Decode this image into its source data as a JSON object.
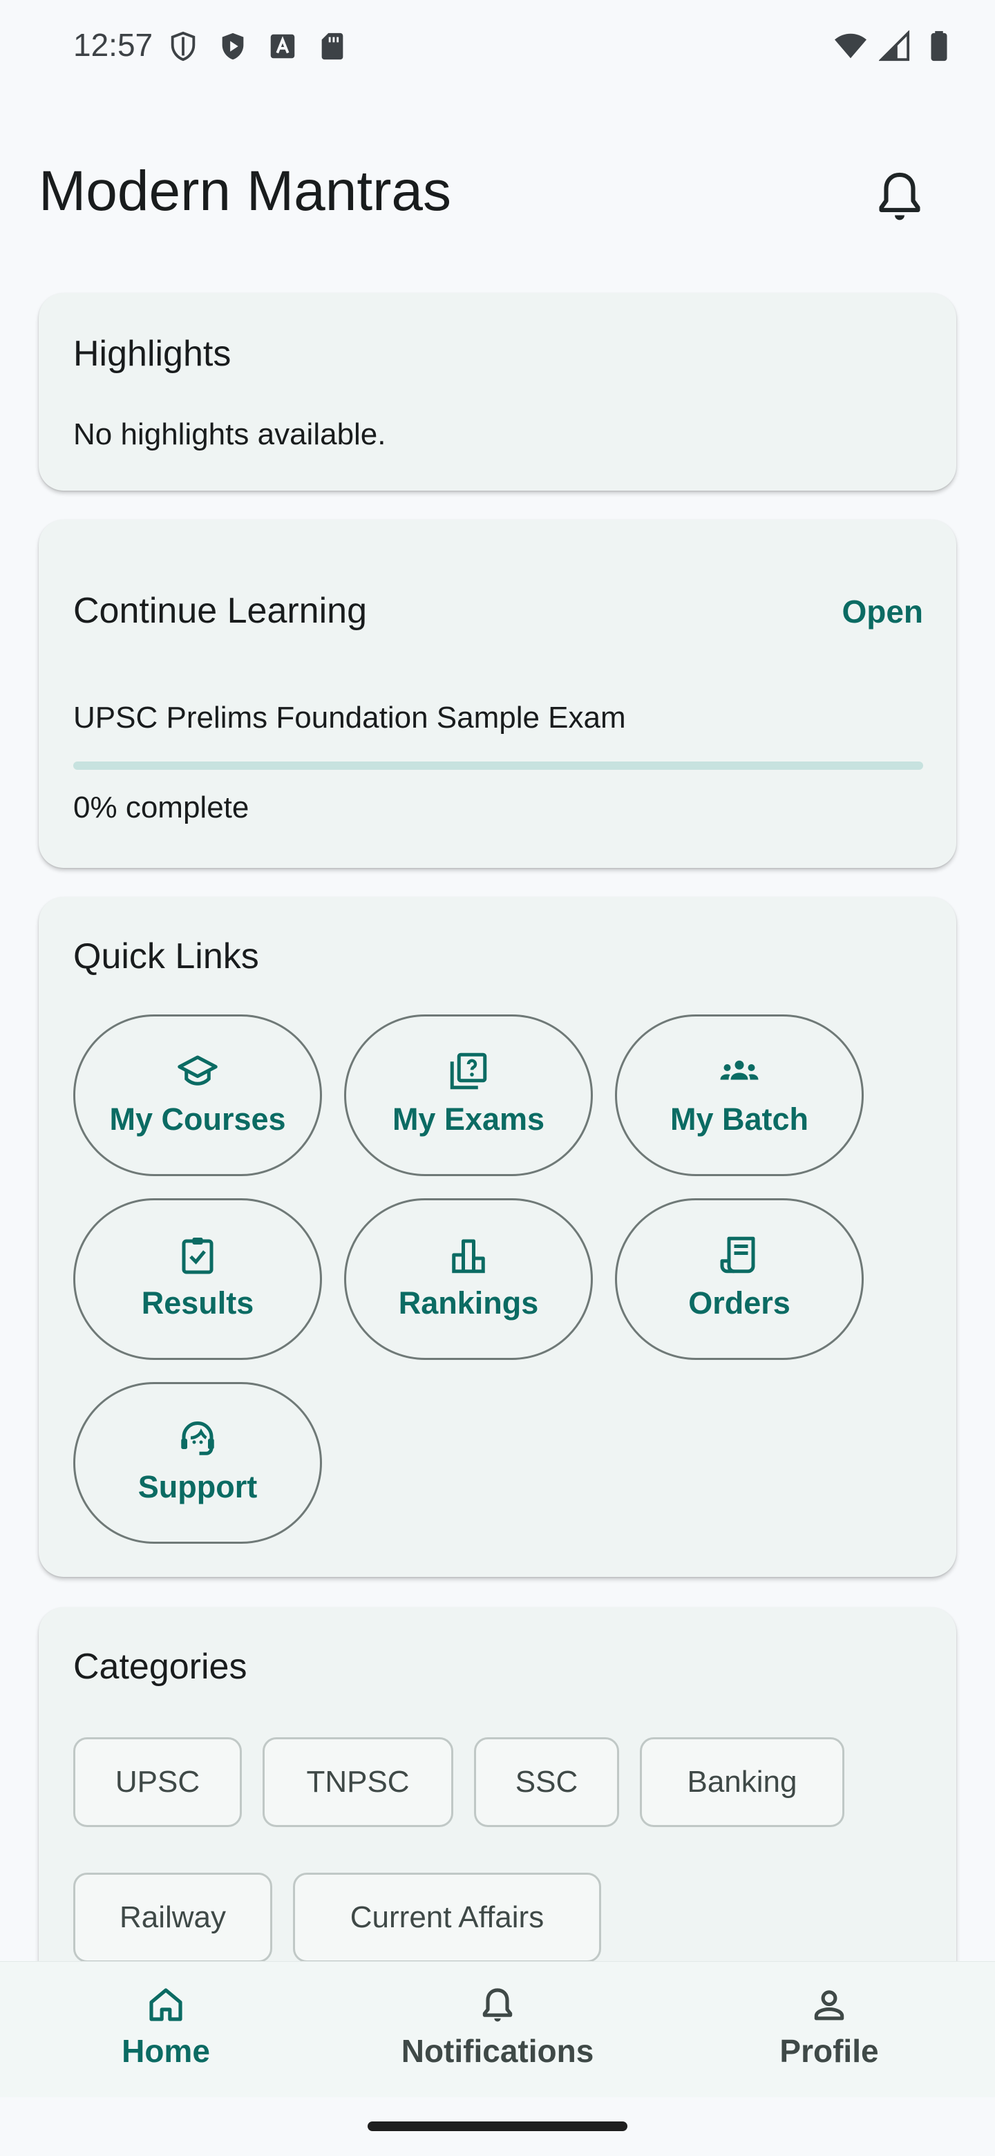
{
  "status_bar": {
    "time": "12:57",
    "left_icons": [
      "shield-outline-icon",
      "shield-play-icon",
      "font-a-icon",
      "sd-card-icon"
    ],
    "right_icons": [
      "wifi-icon",
      "signal-icon",
      "battery-icon"
    ]
  },
  "header": {
    "title": "Modern Mantras",
    "notification_icon": "bell-icon"
  },
  "highlights": {
    "title": "Highlights",
    "message": "No highlights available."
  },
  "continue_learning": {
    "title": "Continue Learning",
    "action_label": "Open",
    "course_name": "UPSC Prelims Foundation Sample Exam",
    "progress_percent": 0,
    "progress_text": "0% complete"
  },
  "quick_links": {
    "title": "Quick Links",
    "items": [
      {
        "label": "My Courses",
        "icon": "graduation-cap-icon"
      },
      {
        "label": "My Exams",
        "icon": "quiz-icon"
      },
      {
        "label": "My Batch",
        "icon": "groups-icon"
      },
      {
        "label": "Results",
        "icon": "assignment-check-icon"
      },
      {
        "label": "Rankings",
        "icon": "leaderboard-icon"
      },
      {
        "label": "Orders",
        "icon": "receipt-icon"
      },
      {
        "label": "Support",
        "icon": "support-agent-icon"
      }
    ]
  },
  "categories": {
    "title": "Categories",
    "items": [
      "UPSC",
      "TNPSC",
      "SSC",
      "Banking",
      "Railway",
      "Current Affairs"
    ]
  },
  "bottom_nav": {
    "items": [
      {
        "label": "Home",
        "icon": "home-icon",
        "active": true
      },
      {
        "label": "Notifications",
        "icon": "bell-icon",
        "active": false
      },
      {
        "label": "Profile",
        "icon": "person-icon",
        "active": false
      }
    ]
  },
  "colors": {
    "accent": "#0b6b63",
    "card_background": "#eff4f3",
    "page_background": "#f7f9fb",
    "progress_track": "#c7e2df"
  }
}
